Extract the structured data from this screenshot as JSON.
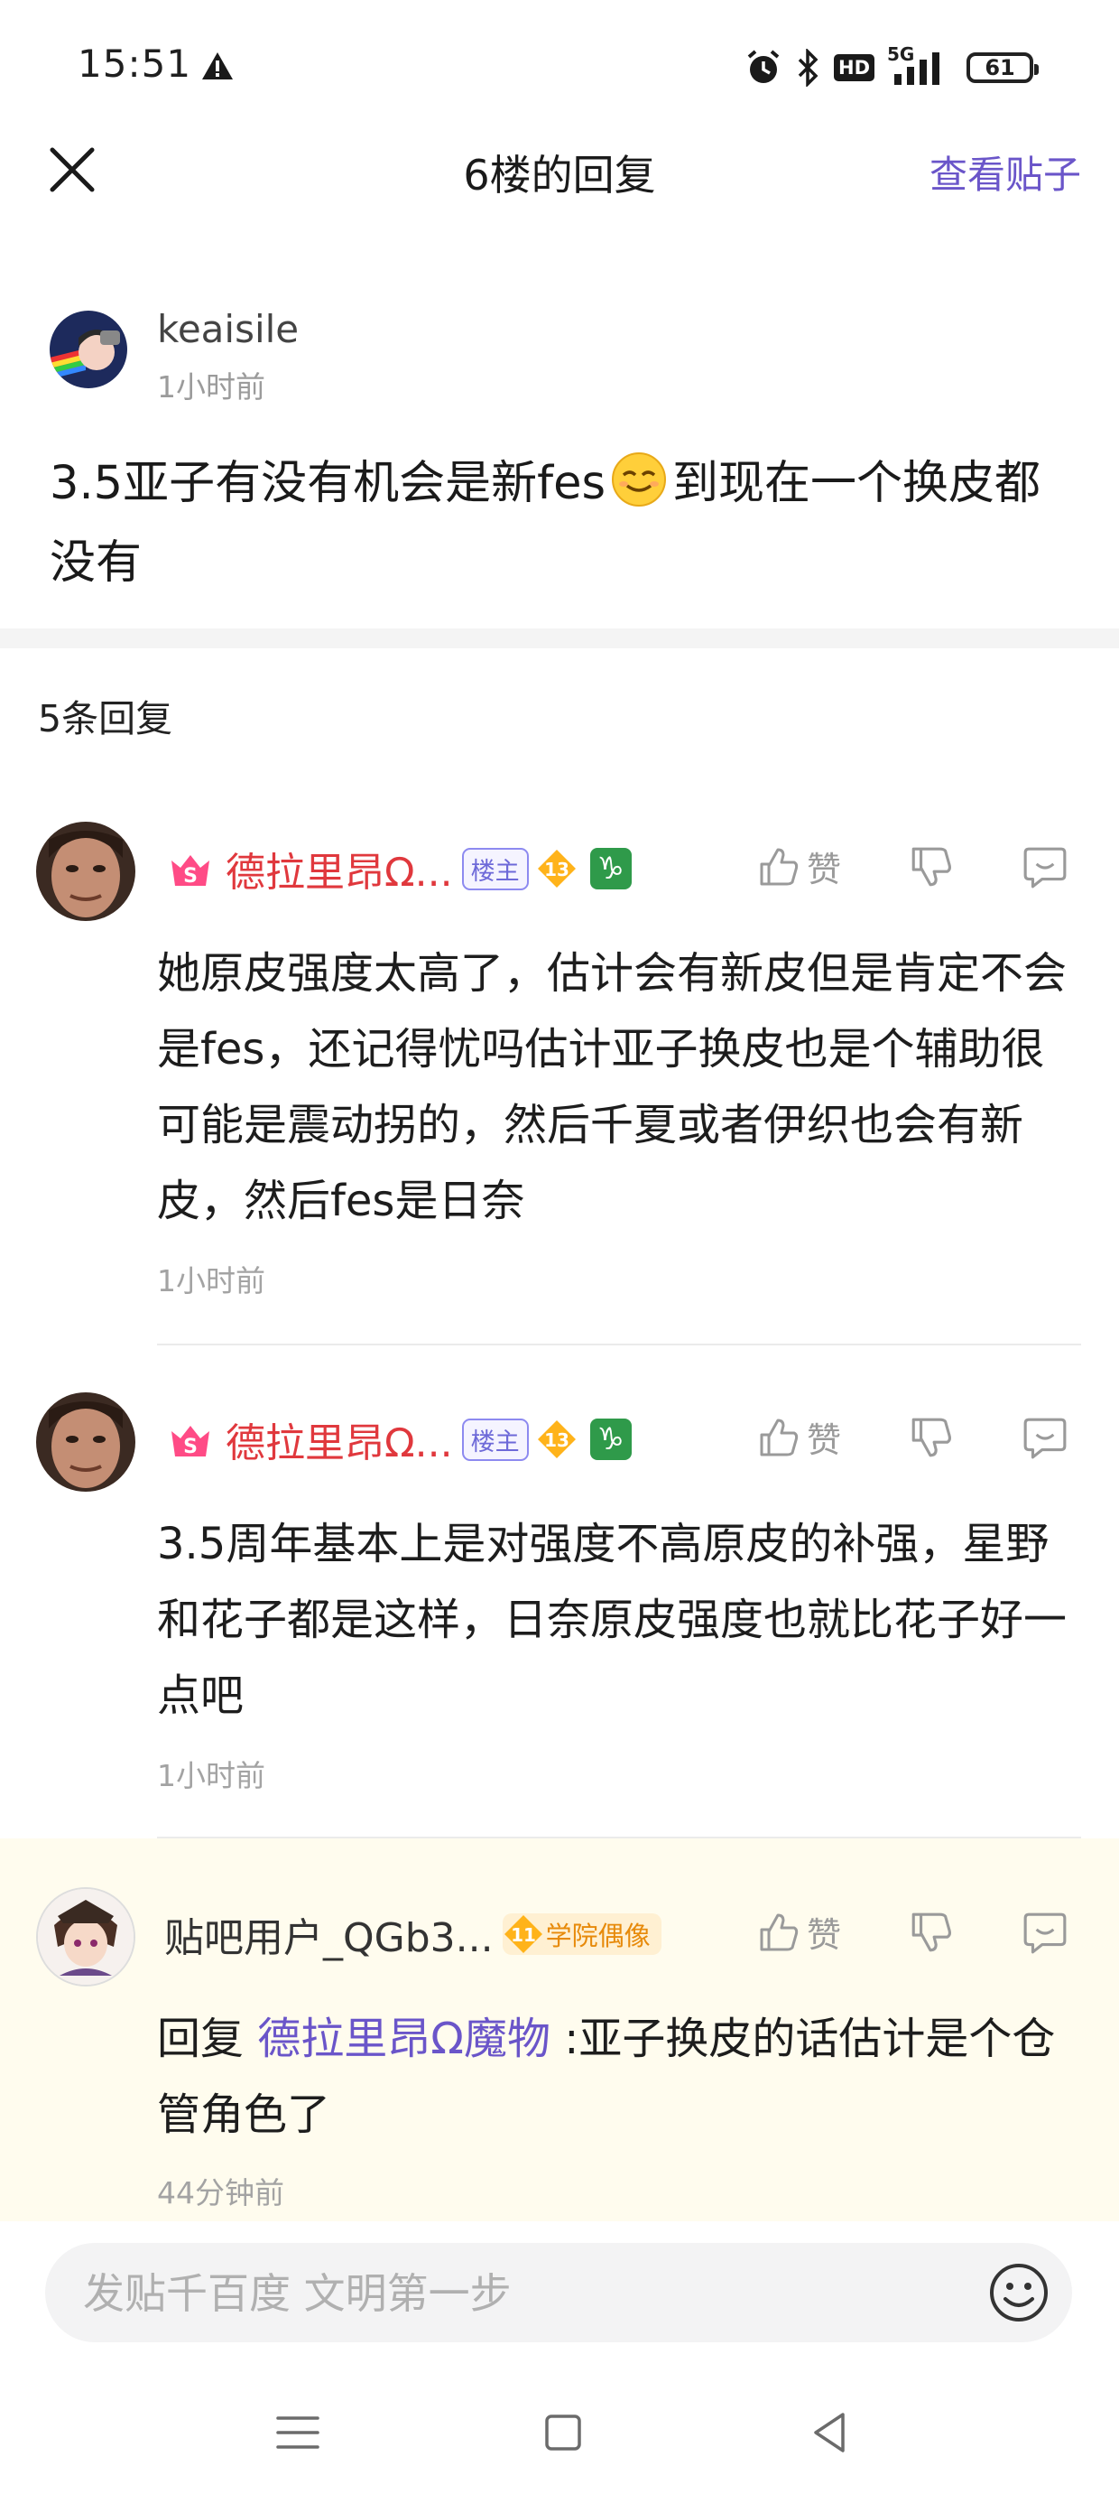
{
  "status_bar": {
    "time": "15:51",
    "battery": "61",
    "network": "5G",
    "hd": "HD"
  },
  "header": {
    "title": "6楼的回复",
    "view_post": "查看贴子"
  },
  "op": {
    "username": "keaisile",
    "time": "1小时前",
    "content_before": "3.5亚子有没有机会是新fes",
    "content_after": "到现在一个换皮都没有"
  },
  "reply_count": "5条回复",
  "replies": [
    {
      "username": "德拉里昂Ω...",
      "owner_badge": "楼主",
      "level": "13",
      "zodiac": "♑",
      "like": "赞",
      "text": "她原皮强度太高了，估计会有新皮但是肯定不会是fes，还记得忧吗估计亚子换皮也是个辅助很可能是震动拐的，然后千夏或者伊织也会有新皮，然后fes是日奈",
      "time": "1小时前"
    },
    {
      "username": "德拉里昂Ω...",
      "owner_badge": "楼主",
      "level": "13",
      "zodiac": "♑",
      "like": "赞",
      "text": "3.5周年基本上是对强度不高原皮的补强，星野和花子都是这样，日奈原皮强度也就比花子好一点吧",
      "time": "1小时前"
    },
    {
      "username": "贴吧用户_QGb3...",
      "level": "11",
      "title_badge": "学院偶像",
      "like": "赞",
      "reply_prefix": "回复",
      "mention": "德拉里昂Ω魔物",
      "text": ":亚子换皮的话估计是个仓管角色了",
      "time": "44分钟前"
    }
  ],
  "input": {
    "placeholder": "发贴千百度 文明第一步"
  },
  "colors": {
    "accent": "#6a55c9",
    "owner_name": "#e0383d",
    "highlight_bg": "#fffcee"
  }
}
